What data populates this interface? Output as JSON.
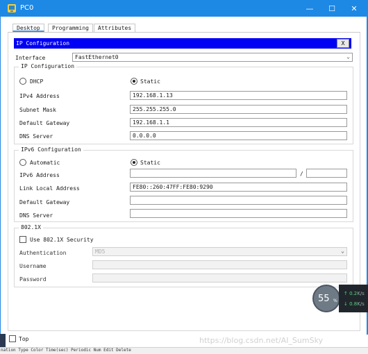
{
  "window": {
    "title": "PC0",
    "minimize_glyph": "—",
    "maximize_glyph": "☐",
    "close_glyph": "✕",
    "accent": "#1e88e5"
  },
  "tabs": [
    {
      "label": "Desktop",
      "active": true
    },
    {
      "label": "Programming",
      "active": false
    },
    {
      "label": "Attributes",
      "active": false
    }
  ],
  "ip_config": {
    "header": "IP Configuration",
    "close_label": "X",
    "interface_label": "Interface",
    "interface_value": "FastEthernet0",
    "ipv4": {
      "legend": "IP Configuration",
      "dhcp_label": "DHCP",
      "static_label": "Static",
      "mode": "Static",
      "ipv4_address_label": "IPv4 Address",
      "ipv4_address": "192.168.1.13",
      "subnet_mask_label": "Subnet Mask",
      "subnet_mask": "255.255.255.0",
      "default_gateway_label": "Default Gateway",
      "default_gateway": "192.168.1.1",
      "dns_server_label": "DNS Server",
      "dns_server": "0.0.0.0"
    },
    "ipv6": {
      "legend": "IPv6 Configuration",
      "automatic_label": "Automatic",
      "static_label": "Static",
      "mode": "Static",
      "ipv6_address_label": "IPv6 Address",
      "ipv6_address": "",
      "prefix_separator": "/",
      "prefix_length": "",
      "link_local_label": "Link Local Address",
      "link_local_address": "FE80::260:47FF:FE80:9290",
      "default_gateway_label": "Default Gateway",
      "default_gateway": "",
      "dns_server_label": "DNS Server",
      "dns_server": ""
    },
    "dot1x": {
      "legend": "802.1X",
      "use_security_label": "Use 802.1X Security",
      "use_security_checked": false,
      "authentication_label": "Authentication",
      "authentication_value": "MD5",
      "username_label": "Username",
      "username": "",
      "password_label": "Password",
      "password": ""
    }
  },
  "top_checkbox": {
    "label": "Top",
    "checked": false
  },
  "overlay": {
    "cpu_value": "55",
    "cpu_unit": "%",
    "net_up": "↑ 0.2",
    "net_up_unit": "K/s",
    "net_down": "↓ 0.8",
    "net_down_unit": "K/s"
  },
  "watermark": "https://blog.csdn.net/AI_SumSky",
  "bottom_strip": "nation  Type  Color  Time(sec)  Periodic  Num  Edit  Delete"
}
